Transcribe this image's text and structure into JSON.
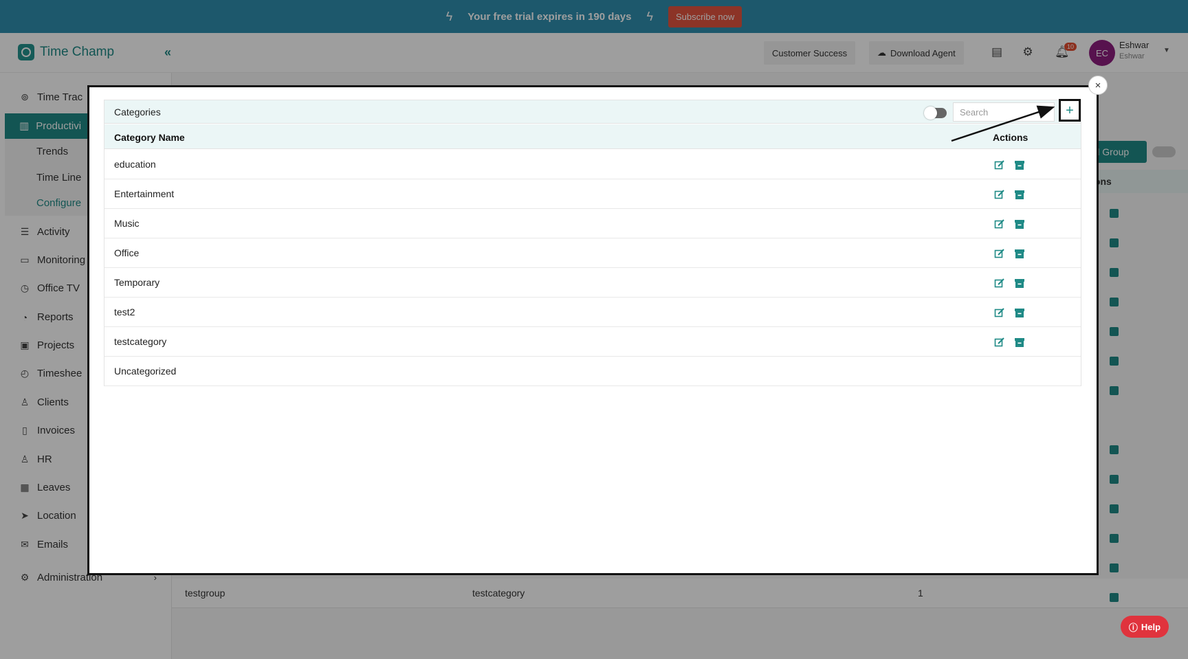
{
  "banner": {
    "trial_text": "Your free trial expires in 190 days",
    "subscribe_label": "Subscribe now"
  },
  "header": {
    "app_name": "Time Champ",
    "customer_success_label": "Customer Success",
    "download_agent_label": "Download Agent",
    "notification_count": "10",
    "user_initials": "EC",
    "user_name": "Eshwar",
    "user_sub": "Eshwar"
  },
  "sidebar": {
    "items": [
      {
        "label": "Time Trac",
        "icon": "clock-icon"
      },
      {
        "label": "Productivi",
        "icon": "chart-icon"
      },
      {
        "label": "Activity",
        "icon": "activity-icon"
      },
      {
        "label": "Monitoring",
        "icon": "monitor-icon"
      },
      {
        "label": "Office TV",
        "icon": "tv-icon"
      },
      {
        "label": "Reports",
        "icon": "pie-icon"
      },
      {
        "label": "Projects",
        "icon": "briefcase-icon"
      },
      {
        "label": "Timeshee",
        "icon": "alarm-icon"
      },
      {
        "label": "Clients",
        "icon": "user-icon"
      },
      {
        "label": "Invoices",
        "icon": "invoice-icon"
      },
      {
        "label": "HR",
        "icon": "person-icon"
      },
      {
        "label": "Leaves",
        "icon": "calendar-icon"
      },
      {
        "label": "Location",
        "icon": "location-icon"
      },
      {
        "label": "Emails",
        "icon": "mail-icon"
      },
      {
        "label": "Administration",
        "icon": "gear-icon"
      }
    ],
    "sub_items": [
      "Trends",
      "Time Line",
      "Configure"
    ]
  },
  "background": {
    "add_group_label": "dd Group",
    "actions_label": "ions",
    "row": {
      "group": "testgroup",
      "category": "testcategory",
      "count": "1"
    }
  },
  "modal": {
    "title": "Categories",
    "search_placeholder": "Search",
    "add_symbol": "+",
    "close_symbol": "×",
    "columns": {
      "name": "Category Name",
      "actions": "Actions"
    },
    "rows": [
      {
        "name": "education",
        "actions": true
      },
      {
        "name": "Entertainment",
        "actions": true
      },
      {
        "name": "Music",
        "actions": true
      },
      {
        "name": "Office",
        "actions": true
      },
      {
        "name": "Temporary",
        "actions": true
      },
      {
        "name": "test2",
        "actions": true
      },
      {
        "name": "testcategory",
        "actions": true
      },
      {
        "name": "Uncategorized",
        "actions": false
      }
    ]
  },
  "help": {
    "label": "Help"
  },
  "colors": {
    "accent": "#1f8a86",
    "banner": "#2f8fae",
    "subscribe": "#e2553f",
    "help": "#e0333d"
  }
}
